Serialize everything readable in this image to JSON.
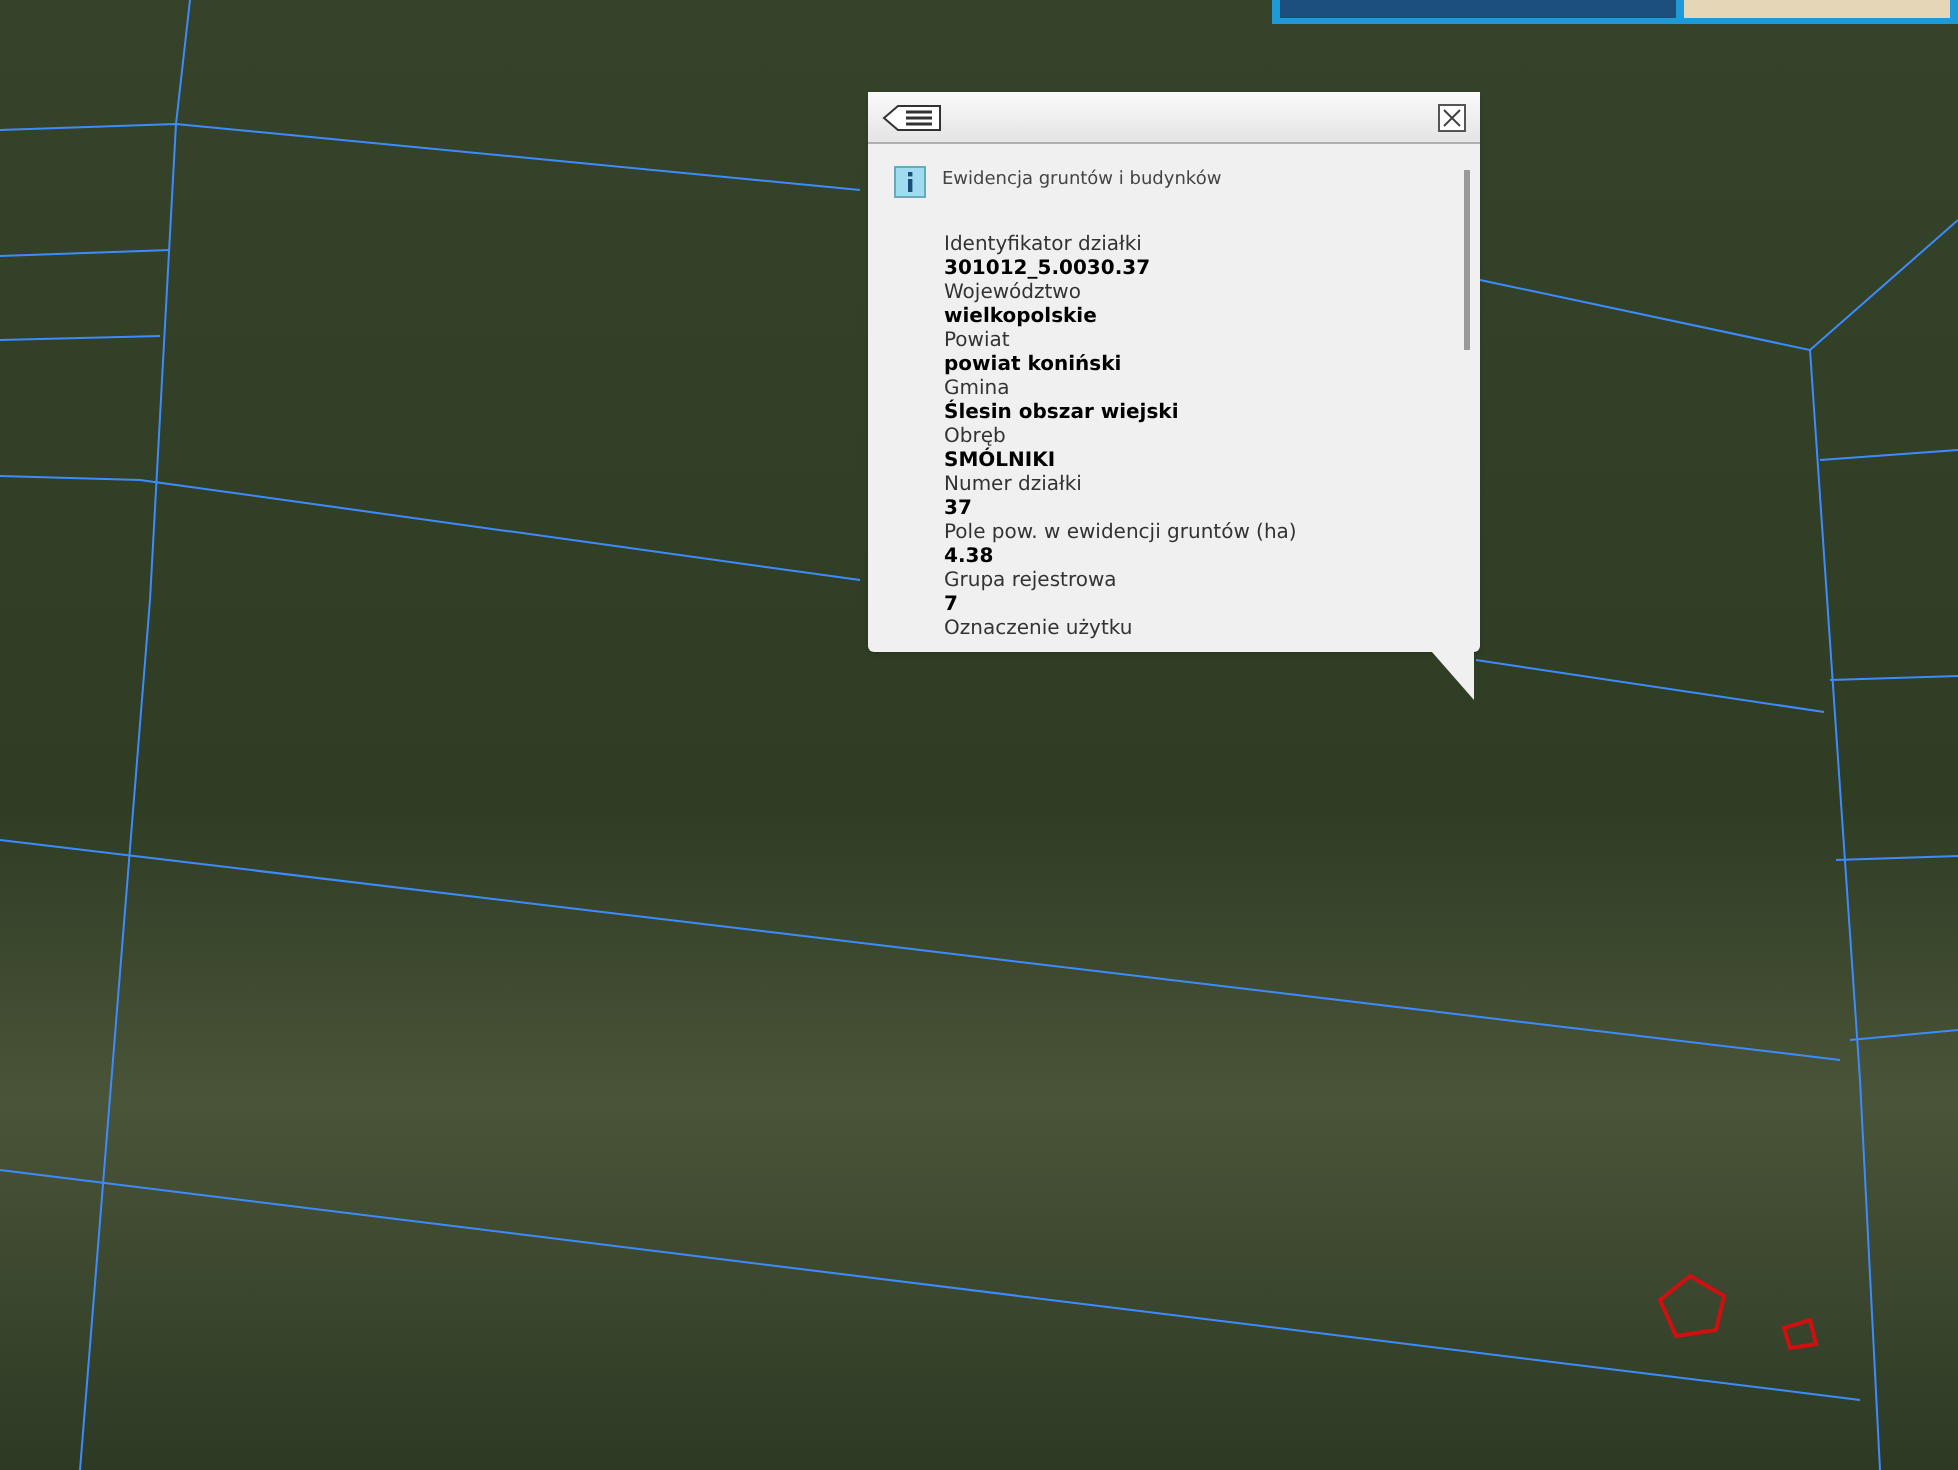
{
  "popup": {
    "source": "Ewidencja gruntów i budynków",
    "fields": [
      {
        "label": "Identyfikator działki",
        "value": "301012_5.0030.37"
      },
      {
        "label": "Województwo",
        "value": "wielkopolskie"
      },
      {
        "label": "Powiat",
        "value": "powiat koniński"
      },
      {
        "label": "Gmina",
        "value": "Ślesin obszar wiejski"
      },
      {
        "label": "Obręb",
        "value": "SMÓLNIKI"
      },
      {
        "label": "Numer działki",
        "value": "37"
      },
      {
        "label": "Pole pow. w ewidencji gruntów (ha)",
        "value": "4.38"
      },
      {
        "label": "Grupa rejestrowa",
        "value": "7"
      },
      {
        "label": "Oznaczenie użytku"
      }
    ]
  }
}
